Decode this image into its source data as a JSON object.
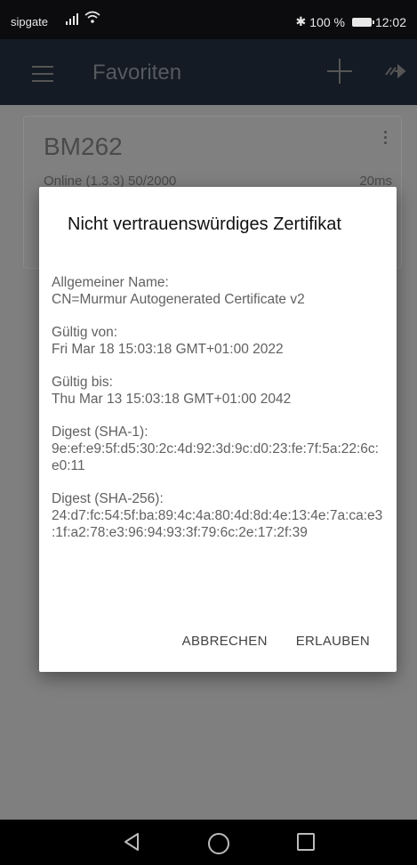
{
  "status_bar": {
    "carrier": "sipgate",
    "bluetooth": "✱",
    "battery_text": "100 %",
    "time": "12:02"
  },
  "app_bar": {
    "title": "Favoriten",
    "icons": [
      "menu-icon",
      "plus-icon",
      "connect-arrow-icon"
    ]
  },
  "server_card": {
    "name": "BM262",
    "status": "Online (1.3.3)  50/2000",
    "ping": "20ms"
  },
  "dialog": {
    "title": "Nicht vertrauenswürdiges Zertifikat",
    "sections": [
      {
        "label": "Allgemeiner Name:",
        "value": "CN=Murmur Autogenerated Certificate v2"
      },
      {
        "label": "Gültig von:",
        "value": "Fri Mar 18 15:03:18 GMT+01:00 2022"
      },
      {
        "label": "Gültig bis:",
        "value": "Thu Mar 13 15:03:18 GMT+01:00 2042"
      },
      {
        "label": "Digest (SHA-1):",
        "value": "9e:ef:e9:5f:d5:30:2c:4d:92:3d:9c:d0:23:fe:7f:5a:22:6c:e0:11"
      },
      {
        "label": "Digest (SHA-256):",
        "value": "24:d7:fc:54:5f:ba:89:4c:4a:80:4d:8d:4e:13:4e:7a:ca:e3:1f:a2:78:e3:96:94:93:3f:79:6c:2e:17:2f:39"
      }
    ],
    "cancel_label": "ABBRECHEN",
    "allow_label": "ERLAUBEN"
  },
  "nav_bar": {
    "icons": [
      "back-icon",
      "home-icon",
      "recents-icon"
    ]
  },
  "colors": {
    "app_bar": "#141b24",
    "scrim": "#7f7f7f",
    "dialog_bg": "#ffffff"
  }
}
